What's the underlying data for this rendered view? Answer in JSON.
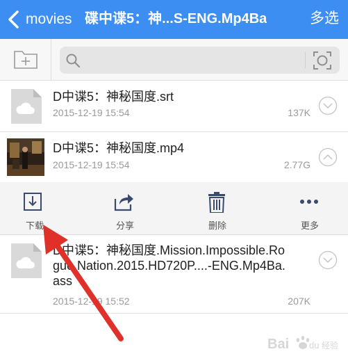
{
  "navbar": {
    "back_label": "movies",
    "title": "碟中谍5：神...S-ENG.Mp4Ba",
    "multiselect_label": "多选",
    "bg_color": "#3d8ef2"
  },
  "search": {
    "placeholder": "",
    "value": ""
  },
  "files": [
    {
      "name": "D中谍5：神秘国度.srt",
      "date": "2015-12-19 15:54",
      "size": "137K",
      "icon": "cloud-document-icon",
      "expanded": false
    },
    {
      "name": "D中谍5：神秘国度.mp4",
      "date": "2015-12-19 15:54",
      "size": "2.77G",
      "icon": "video-thumbnail",
      "expanded": true
    },
    {
      "name": "D中谍5：神秘国度.Mission.Impossible.Rogue.Nation.2015.HD720P....-ENG.Mp4Ba.ass",
      "date": "2015-12-19 15:52",
      "size": "207K",
      "icon": "cloud-document-icon",
      "expanded": false
    }
  ],
  "actions": {
    "download": "下载",
    "share": "分享",
    "delete": "删除",
    "more": "更多"
  },
  "watermark": {
    "logo_text": "Bai du 经验"
  },
  "annotation": {
    "arrow_color": "#e0302a"
  }
}
